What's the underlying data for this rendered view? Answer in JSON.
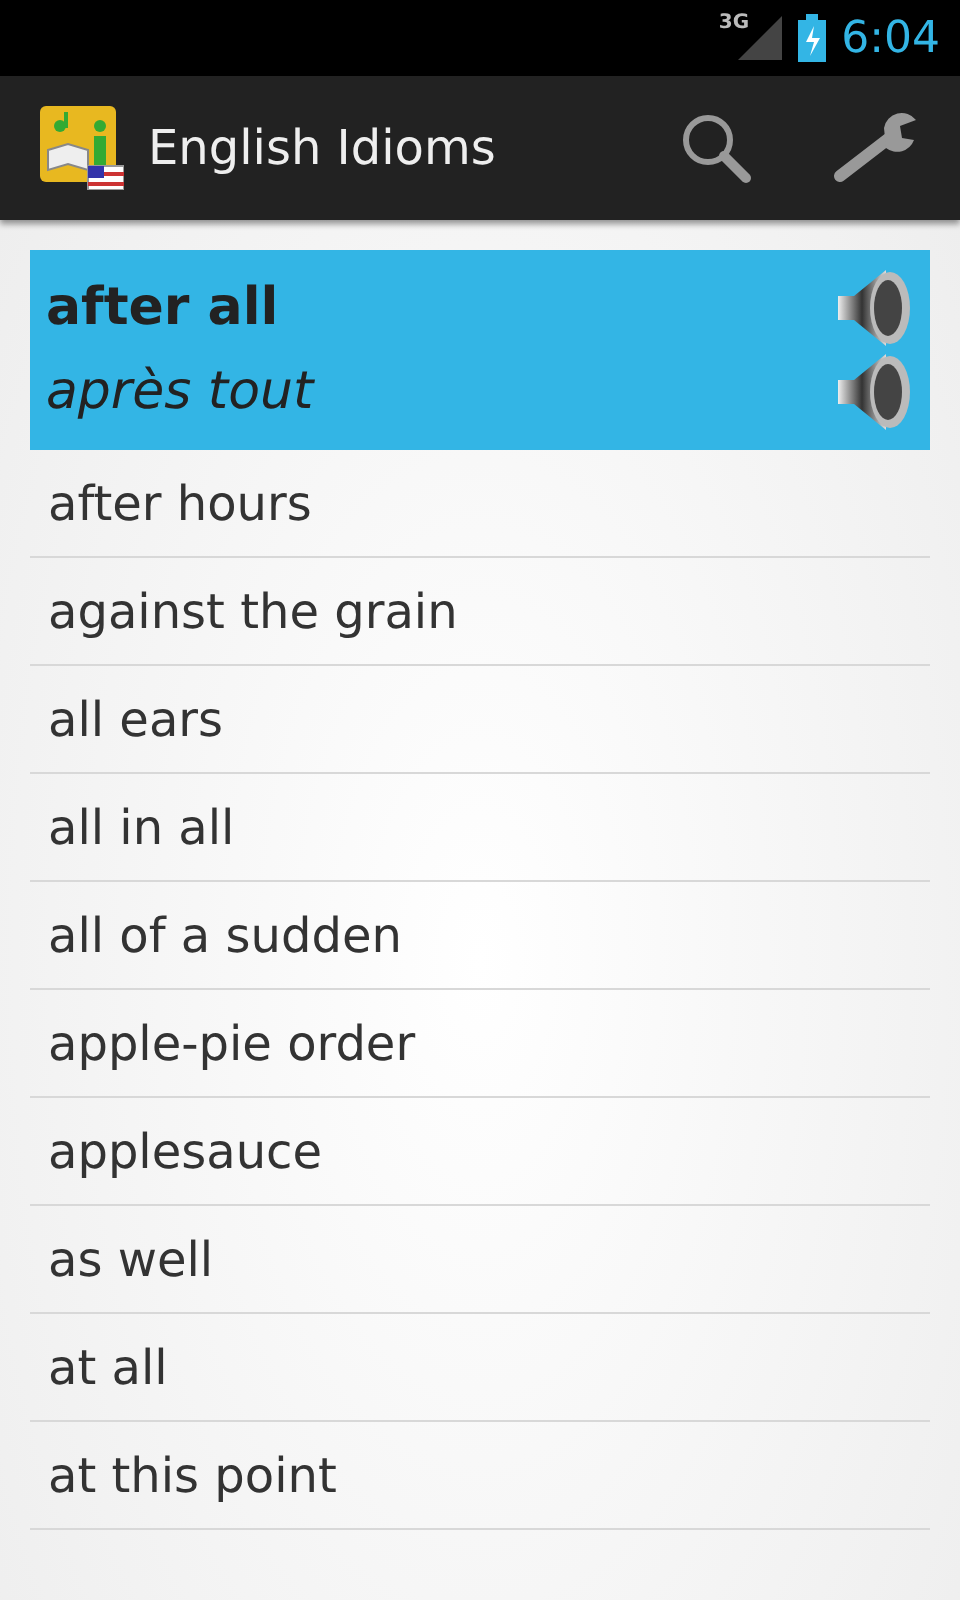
{
  "status_bar": {
    "network": "3G",
    "time": "6:04"
  },
  "action_bar": {
    "title": "English Idioms"
  },
  "selected_entry": {
    "phrase": "after all",
    "translation": "après tout"
  },
  "entries": [
    "after hours",
    "against the grain",
    "all ears",
    "all in all",
    "all of a sudden",
    "apple-pie order",
    "applesauce",
    "as well",
    "at all",
    "at this point"
  ]
}
